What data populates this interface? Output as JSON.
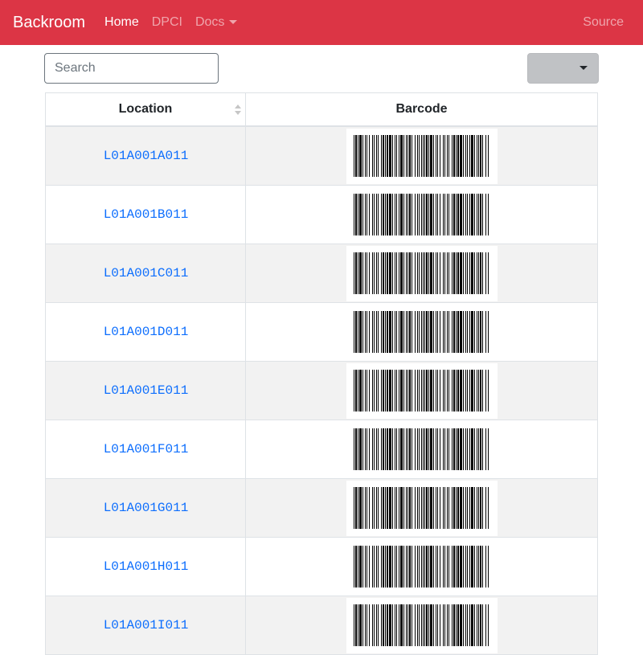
{
  "navbar": {
    "brand": "Backroom",
    "links": [
      {
        "label": "Home",
        "active": true
      },
      {
        "label": "DPCI",
        "active": false
      },
      {
        "label": "Docs",
        "active": false,
        "dropdown": true
      }
    ],
    "right_link": "Source"
  },
  "toolbar": {
    "search_placeholder": "Search",
    "dropdown_label": ""
  },
  "table": {
    "headers": {
      "location": "Location",
      "barcode": "Barcode"
    },
    "rows": [
      {
        "location": "L01A001A011",
        "barcode_icon": "barcode"
      },
      {
        "location": "L01A001B011",
        "barcode_icon": "barcode"
      },
      {
        "location": "L01A001C011",
        "barcode_icon": "barcode"
      },
      {
        "location": "L01A001D011",
        "barcode_icon": "barcode"
      },
      {
        "location": "L01A001E011",
        "barcode_icon": "barcode"
      },
      {
        "location": "L01A001F011",
        "barcode_icon": "barcode"
      },
      {
        "location": "L01A001G011",
        "barcode_icon": "barcode"
      },
      {
        "location": "L01A001H011",
        "barcode_icon": "barcode"
      },
      {
        "location": "L01A001I011",
        "barcode_icon": "barcode"
      }
    ]
  },
  "colors": {
    "navbar": "#dc3545",
    "link": "#0d6efd",
    "stripe": "#f2f2f2"
  }
}
